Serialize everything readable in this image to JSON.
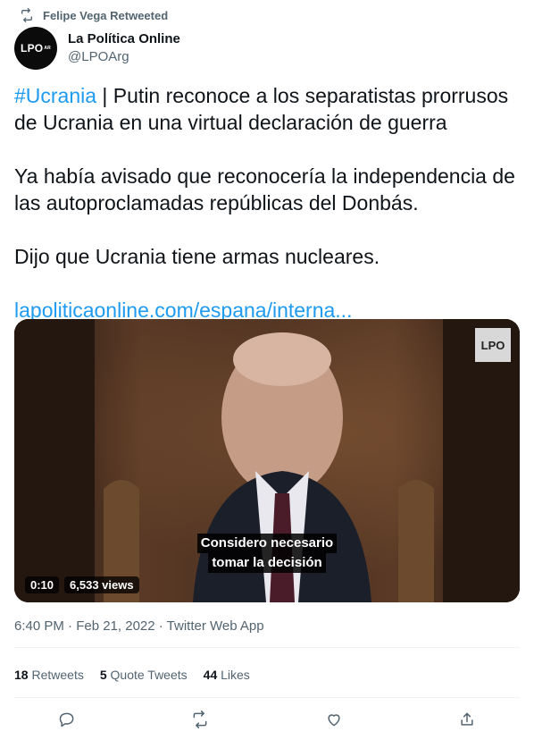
{
  "retweet_header": {
    "label": "Felipe Vega Retweeted",
    "icon": "retweet-icon"
  },
  "author": {
    "display_name": "La Política Online",
    "handle": "@LPOArg",
    "avatar_text": "LPO",
    "avatar_sup": "AR"
  },
  "tweet": {
    "hashtag": "#Ucrania",
    "line1_rest": " | Putin reconoce a los separatistas prorrusos de Ucrania en una virtual declaración de guerra",
    "para2": "Ya había avisado que reconocería la independencia de las autoproclamadas repúblicas del Donbás.",
    "para3": "Dijo que Ucrania tiene armas nucleares.",
    "link": "lapoliticaonline.com/espana/interna..."
  },
  "media": {
    "watermark": "LPO",
    "subtitle_line1": "Considero necesario",
    "subtitle_line2": "tomar la decisión",
    "time": "0:10",
    "views": "6,533 views"
  },
  "meta": {
    "timestamp": "6:40 PM · Feb 21, 2022 · Twitter Web App"
  },
  "stats": {
    "retweets_count": "18",
    "retweets_label": "Retweets",
    "quotes_count": "5",
    "quotes_label": "Quote Tweets",
    "likes_count": "44",
    "likes_label": "Likes"
  },
  "colors": {
    "link": "#1d9bf0",
    "muted": "#536471",
    "text": "#0f1419"
  }
}
